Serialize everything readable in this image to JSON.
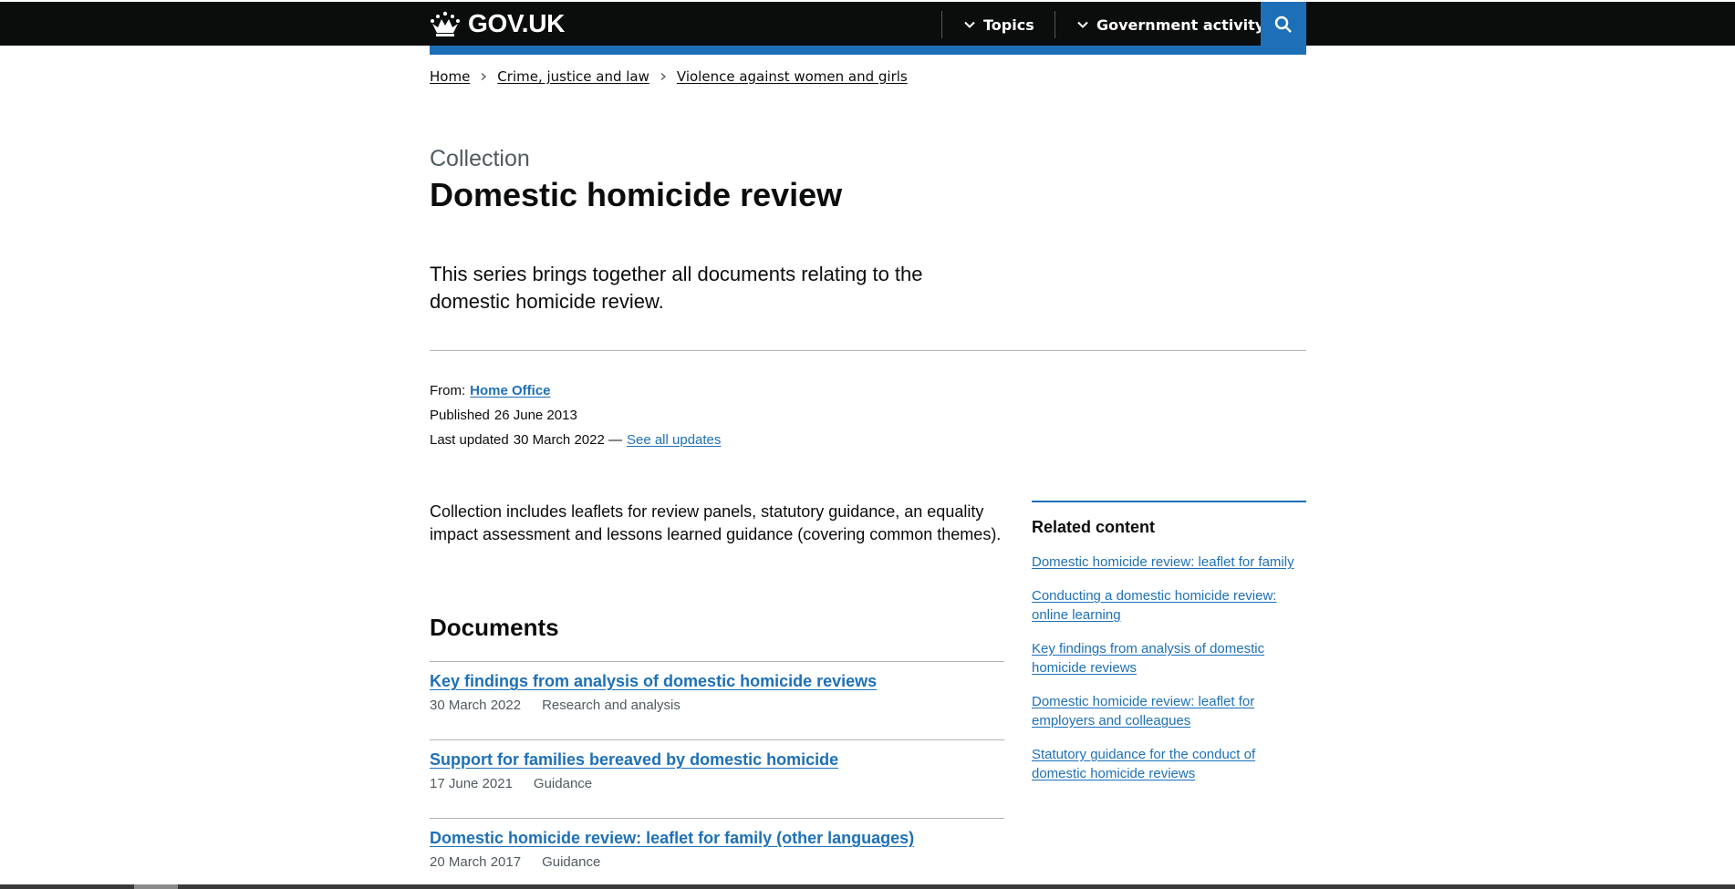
{
  "header": {
    "logo_text": "GOV.UK",
    "nav": [
      {
        "label": "Topics"
      },
      {
        "label": "Government activity"
      }
    ],
    "accent_color": "#1d70b8"
  },
  "breadcrumbs": [
    "Home",
    "Crime, justice and law",
    "Violence against women and girls"
  ],
  "page": {
    "caption": "Collection",
    "title": "Domestic homicide review",
    "lead": "This series brings together all documents relating to the domestic homicide review."
  },
  "meta": {
    "from_label": "From:",
    "from_value": "Home Office",
    "published_label": "Published",
    "published_value": "26 June 2013",
    "updated_label": "Last updated",
    "updated_value": "30 March 2022 —",
    "see_all_updates": "See all updates"
  },
  "body_text": "Collection includes leaflets for review panels, statutory guidance, an equality impact assessment and lessons learned guidance (covering common themes).",
  "documents": {
    "heading": "Documents",
    "items": [
      {
        "title": "Key findings from analysis of domestic homicide reviews",
        "date": "30 March 2022",
        "type": "Research and analysis"
      },
      {
        "title": "Support for families bereaved by domestic homicide",
        "date": "17 June 2021",
        "type": "Guidance"
      },
      {
        "title": "Domestic homicide review: leaflet for family (other languages)",
        "date": "20 March 2017",
        "type": "Guidance"
      }
    ]
  },
  "related": {
    "heading": "Related content",
    "links": [
      "Domestic homicide review: leaflet for family",
      "Conducting a domestic homicide review: online learning",
      "Key findings from analysis of domestic homicide reviews",
      "Domestic homicide review: leaflet for employers and colleagues",
      "Statutory guidance for the conduct of domestic homicide reviews"
    ]
  }
}
